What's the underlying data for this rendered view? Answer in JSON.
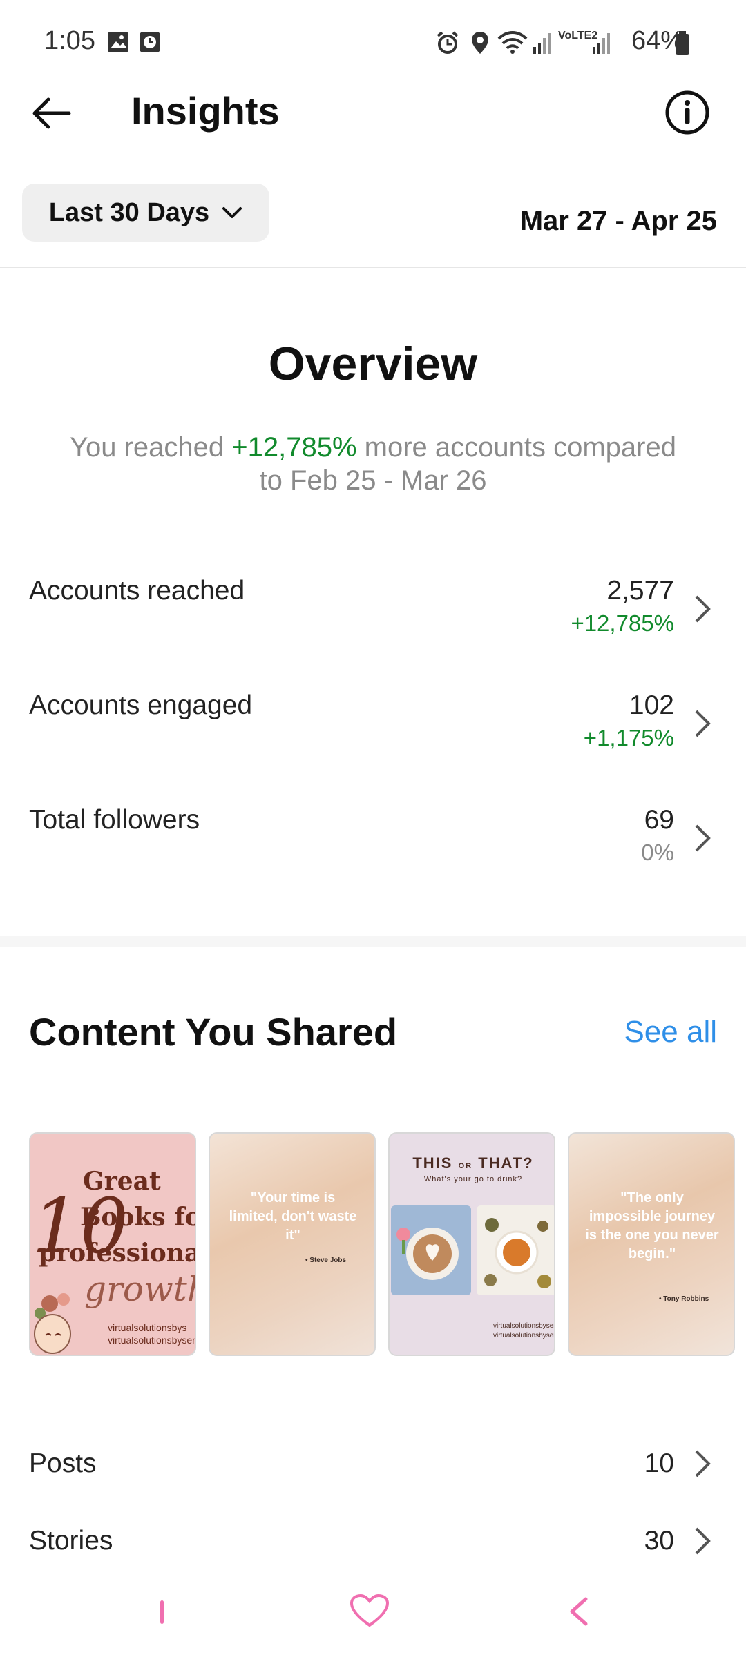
{
  "status_bar": {
    "time": "1:05",
    "battery": "64%",
    "network_label": "VoLTE2"
  },
  "header": {
    "title": "Insights"
  },
  "date_range": {
    "selector_label": "Last 30 Days",
    "range_text": "Mar 27 - Apr 25"
  },
  "overview": {
    "title": "Overview",
    "desc_prefix": "You reached ",
    "desc_highlight": "+12,785%",
    "desc_suffix": " more accounts compared to Feb 25 - Mar 26",
    "metrics": [
      {
        "label": "Accounts reached",
        "value": "2,577",
        "change": "+12,785%"
      },
      {
        "label": "Accounts engaged",
        "value": "102",
        "change": "+1,175%"
      },
      {
        "label": "Total followers",
        "value": "69",
        "change": "0%"
      }
    ]
  },
  "content": {
    "title": "Content You Shared",
    "see_all": "See all",
    "thumbnails": [
      {
        "line1": "Great",
        "line2": "Books fo",
        "line3": "professiona",
        "big": "10",
        "script": "growth",
        "handle1": "virtualsolutionsbys",
        "handle2": "virtualsolutionsbysen"
      },
      {
        "quote": "\"Your time is limited, don't waste it\"",
        "author": "• Steve Jobs"
      },
      {
        "title_a": "THIS",
        "title_or": "OR",
        "title_b": "THAT?",
        "subtitle": "What's your go to drink?",
        "handle1": "virtualsolutionsbysen",
        "handle2": "virtualsolutionsbysen"
      },
      {
        "quote": "\"The only impossible journey is the one you never begin.\"",
        "author": "• Tony Robbins"
      }
    ],
    "list": [
      {
        "label": "Posts",
        "value": "10"
      },
      {
        "label": "Stories",
        "value": "30"
      }
    ]
  }
}
